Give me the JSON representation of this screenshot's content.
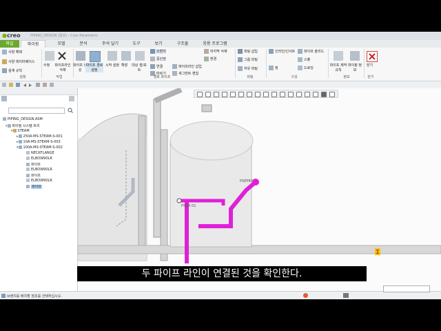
{
  "app": {
    "logo": "creo",
    "title": "PIPING_DESIGN (활성) - Creo Parametric",
    "accent": "#6aa92f",
    "pipe_color": "#e020d8"
  },
  "tabs": [
    {
      "label": "파일"
    },
    {
      "label": "파이핑"
    },
    {
      "label": "모델"
    },
    {
      "label": "분석"
    },
    {
      "label": "주석 달기"
    },
    {
      "label": "도구"
    },
    {
      "label": "보기"
    },
    {
      "label": "구조물"
    },
    {
      "label": "응용 프로그램"
    }
  ],
  "ribbon": {
    "small_left": [
      "사양 해제",
      "사양 데이터베이스",
      "설계 규칙"
    ],
    "big_buttons": [
      "수정",
      "파이프라인 삭제",
      "파이프 생성",
      "파이프 경로 설정",
      "시작 설정",
      "확장",
      "대상 점/포트"
    ],
    "routing_small": [
      "쓰면지",
      "중단점",
      "연결",
      "파이프라인 삽입",
      "따르기",
      "세그먼트 편집",
      "마지막 삭제",
      "환경"
    ],
    "fitting_small": [
      "피팅 삽입",
      "그룹 피팅",
      "자유 피팅"
    ],
    "config_small": [
      "인라인/인서트",
      "파이프 솔리드",
      "스풀",
      "드로잉",
      "정"
    ],
    "info_big": [
      "파이프 제작 규칙",
      "파이핑 정보"
    ],
    "close_big": [
      "닫기"
    ],
    "groups": [
      "설정",
      "작업",
      "경로 파이프",
      "피팅",
      "구성",
      "정보",
      "닫기"
    ]
  },
  "tree": {
    "root": "PIPING_DESIGN.ASM",
    "system": "파이핑 시스템 트리",
    "steam": "STEAM",
    "lines": [
      "250A-MS-STEAM-S-001",
      "10A-MS-STEAM-S-003",
      "100A-MS-STEAM-S-002"
    ],
    "children": [
      "NECKFLANGE",
      "ELBOW90LR",
      "파이프",
      "ELBOW90LR",
      "파이프",
      "ELBOW90LR",
      "파이프"
    ]
  },
  "viewport": {
    "label_a": "PSEPRP",
    "label_b": "PSGR 01"
  },
  "status": {
    "message": "브랜치를 배치할 점조를 선택하십시오."
  },
  "subtitle": "두 파이프 라인이 연결된 것을 확인한다."
}
